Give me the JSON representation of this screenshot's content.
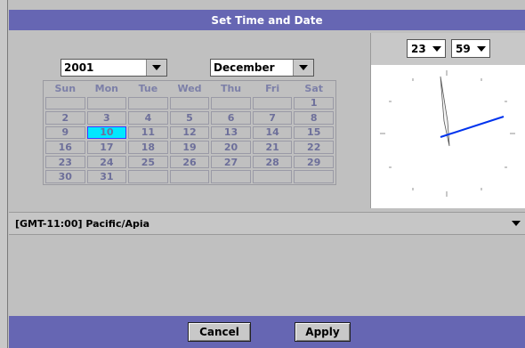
{
  "dialog": {
    "title": "Set Time and Date"
  },
  "calendar": {
    "year": "2001",
    "month": "December",
    "weekdays": [
      "Sun",
      "Mon",
      "Tue",
      "Wed",
      "Thu",
      "Fri",
      "Sat"
    ],
    "rows": [
      [
        "",
        "",
        "",
        "",
        "",
        "",
        "1"
      ],
      [
        "2",
        "3",
        "4",
        "5",
        "6",
        "7",
        "8"
      ],
      [
        "9",
        "10",
        "11",
        "12",
        "13",
        "14",
        "15"
      ],
      [
        "16",
        "17",
        "18",
        "19",
        "20",
        "21",
        "22"
      ],
      [
        "23",
        "24",
        "25",
        "26",
        "27",
        "28",
        "29"
      ],
      [
        "30",
        "31",
        "",
        "",
        "",
        "",
        ""
      ]
    ],
    "selected_day": "10",
    "selected_color": "#00e8ff"
  },
  "clock": {
    "hour": "23",
    "minute": "59"
  },
  "timezone": {
    "value": "[GMT-11:00]  Pacific/Apia"
  },
  "buttons": {
    "cancel": "Cancel",
    "apply": "Apply"
  },
  "colors": {
    "titlebar": "#6666b3",
    "minute_hand": "#0033ee"
  }
}
